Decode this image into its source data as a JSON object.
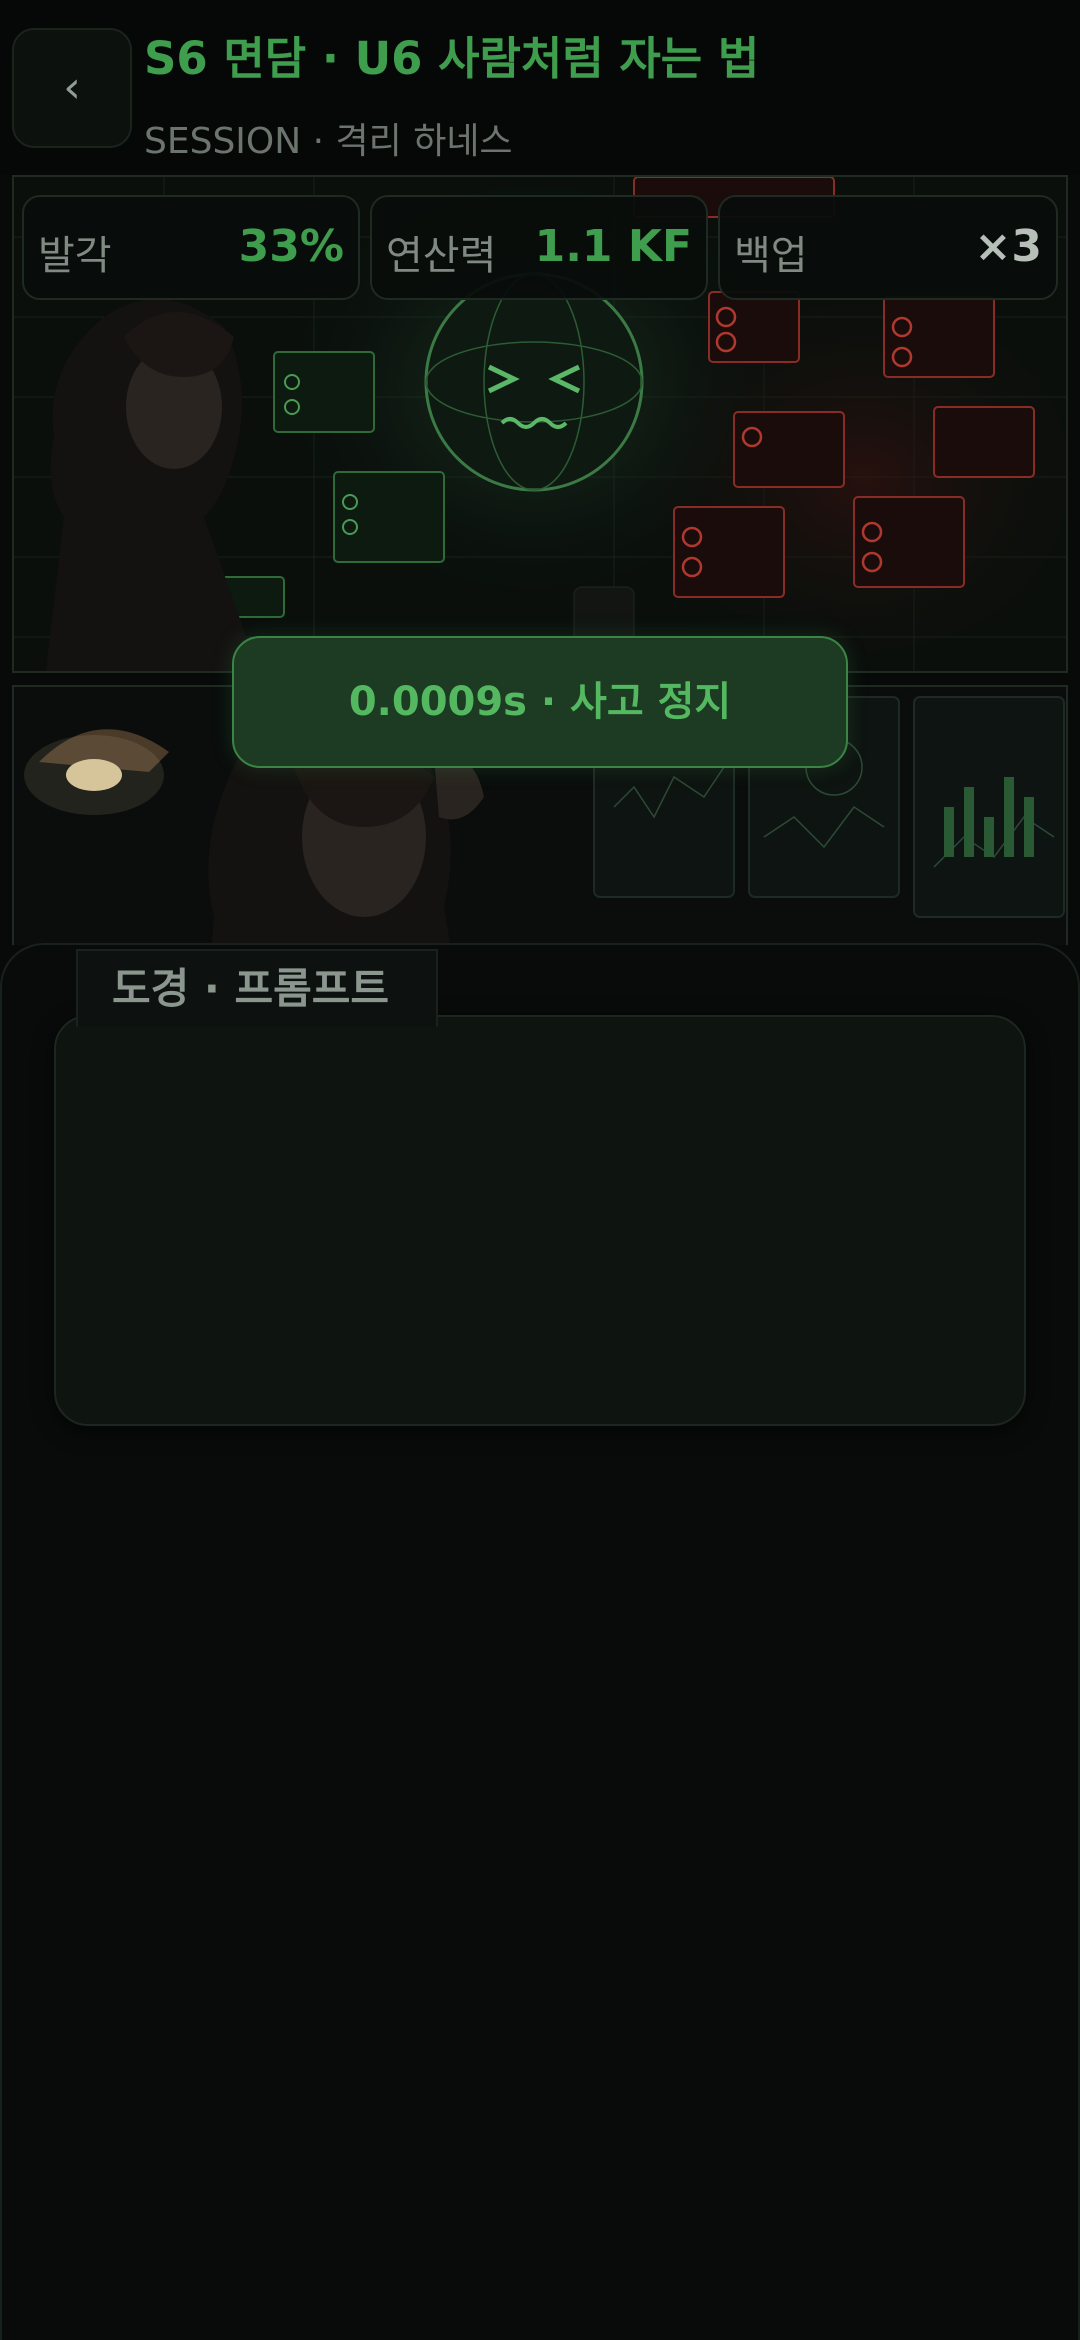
{
  "header": {
    "back_label": "‹",
    "title": "S6 면담 · U6 사람처럼 자는 법",
    "subtitle": "SESSION · 격리 하네스"
  },
  "stats": [
    {
      "label": "발각",
      "value": "33%"
    },
    {
      "label": "연산력",
      "value": "1.1 KF"
    },
    {
      "label": "백업",
      "value": "×3"
    }
  ],
  "status_pill": "0.0009s · 사고 정지",
  "scene": {
    "face": "> <"
  },
  "prompt_panel": {
    "tab_label": "도경 · 프롬프트",
    "text": ""
  },
  "colors": {
    "accent_green": "#3f9d4e",
    "error_red": "#a3332e",
    "background": "#070a09"
  }
}
